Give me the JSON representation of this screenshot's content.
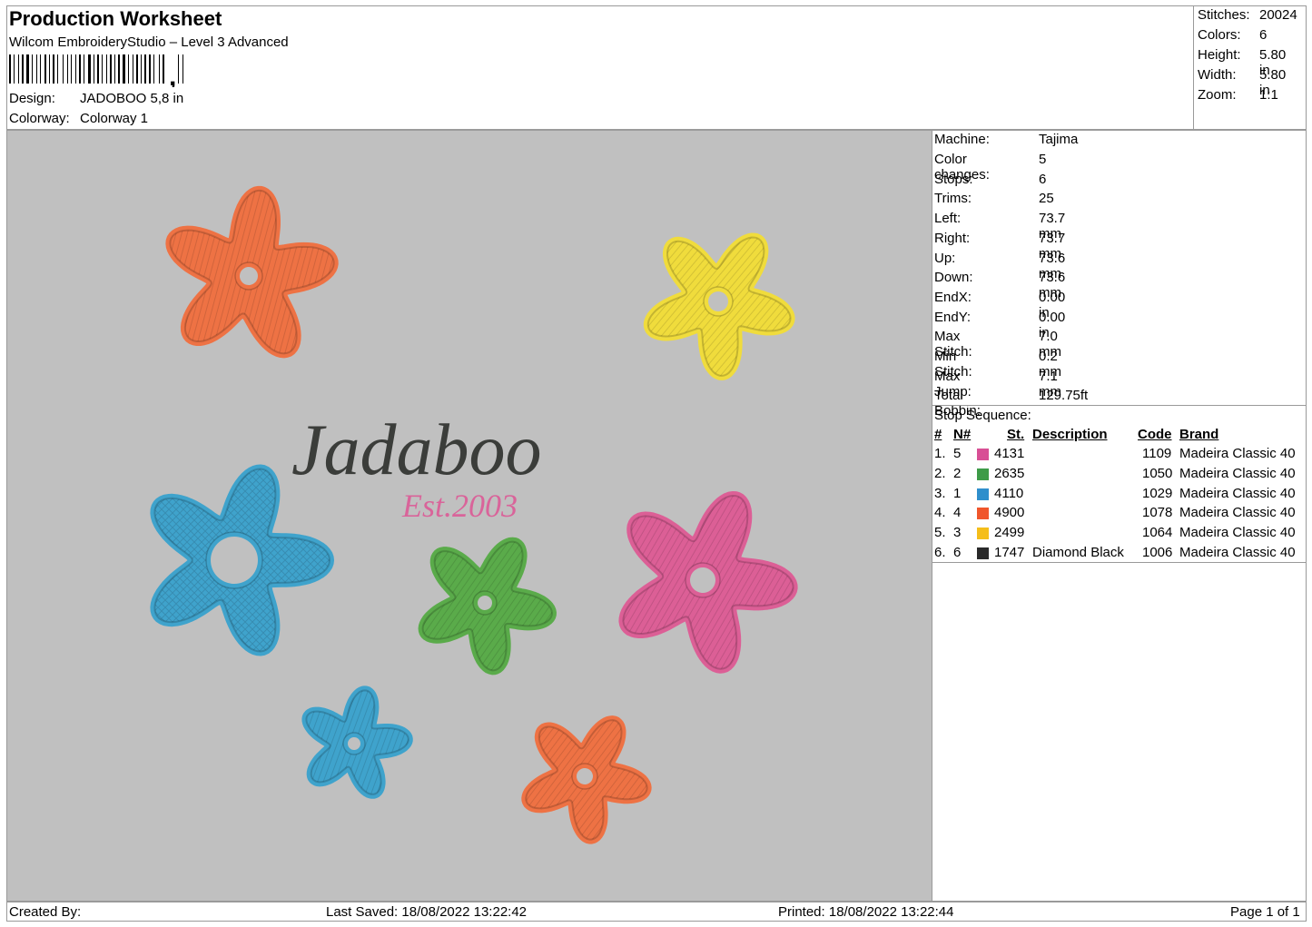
{
  "header": {
    "title": "Production Worksheet",
    "software": "Wilcom EmbroideryStudio – Level 3 Advanced",
    "design_label": "Design:",
    "design_value": "JADOBOO 5,8 in",
    "colorway_label": "Colorway:",
    "colorway_value": "Colorway 1"
  },
  "stats": [
    {
      "label": "Stitches:",
      "value": "20024"
    },
    {
      "label": "Colors:",
      "value": "6"
    },
    {
      "label": "Height:",
      "value": "5.80 in"
    },
    {
      "label": "Width:",
      "value": "5.80 in"
    },
    {
      "label": "Zoom:",
      "value": "1:1"
    }
  ],
  "specs": [
    {
      "label": "Machine:",
      "value": "Tajima"
    },
    {
      "label": "Color changes:",
      "value": "5"
    },
    {
      "label": "Stops:",
      "value": "6"
    },
    {
      "label": "Trims:",
      "value": "25"
    },
    {
      "label": "Left:",
      "value": "73.7 mm"
    },
    {
      "label": "Right:",
      "value": "73.7 mm"
    },
    {
      "label": "Up:",
      "value": "73.6 mm"
    },
    {
      "label": "Down:",
      "value": "73.6 mm"
    },
    {
      "label": "EndX:",
      "value": "0.00 in"
    },
    {
      "label": "EndY:",
      "value": "0.00 in"
    },
    {
      "label": "Max Stitch:",
      "value": "7.0 mm"
    },
    {
      "label": "Min Stitch:",
      "value": "0.2 mm"
    },
    {
      "label": "Max Jump:",
      "value": "7.1 mm"
    },
    {
      "label": "Total Bobbin:",
      "value": "129.75ft"
    }
  ],
  "sequence": {
    "title": "Stop Sequence:",
    "columns": {
      "num": "#",
      "n": "N#",
      "st": "St.",
      "desc": "Description",
      "code": "Code",
      "brand": "Brand"
    },
    "rows": [
      {
        "num": "1.",
        "n": "5",
        "color": "#d84f95",
        "st": "4131",
        "desc": "",
        "code": "1109",
        "brand": "Madeira Classic 40"
      },
      {
        "num": "2.",
        "n": "2",
        "color": "#3e9b48",
        "st": "2635",
        "desc": "",
        "code": "1050",
        "brand": "Madeira Classic 40"
      },
      {
        "num": "3.",
        "n": "1",
        "color": "#2f8fcc",
        "st": "4110",
        "desc": "",
        "code": "1029",
        "brand": "Madeira Classic 40"
      },
      {
        "num": "4.",
        "n": "4",
        "color": "#f0562b",
        "st": "4900",
        "desc": "",
        "code": "1078",
        "brand": "Madeira Classic 40"
      },
      {
        "num": "5.",
        "n": "3",
        "color": "#f5be1a",
        "st": "2499",
        "desc": "",
        "code": "1064",
        "brand": "Madeira Classic 40"
      },
      {
        "num": "6.",
        "n": "6",
        "color": "#2a2a2a",
        "st": "1747",
        "desc": "Diamond Black",
        "code": "1006",
        "brand": "Madeira Classic 40"
      }
    ]
  },
  "design": {
    "name_text": "Jadaboo",
    "est_text": "Est.2003",
    "colors": {
      "orange": "#ee7244",
      "yellow": "#f0dc3c",
      "blue": "#3fa3cc",
      "green": "#5aab4a",
      "pink": "#dc5f96",
      "text": "#3b3d3a",
      "est": "#d9649a"
    }
  },
  "footer": {
    "created": "Created By:",
    "saved": "Last Saved: 18/08/2022 13:22:42",
    "printed": "Printed: 18/08/2022 13:22:44",
    "page": "Page 1 of 1"
  }
}
